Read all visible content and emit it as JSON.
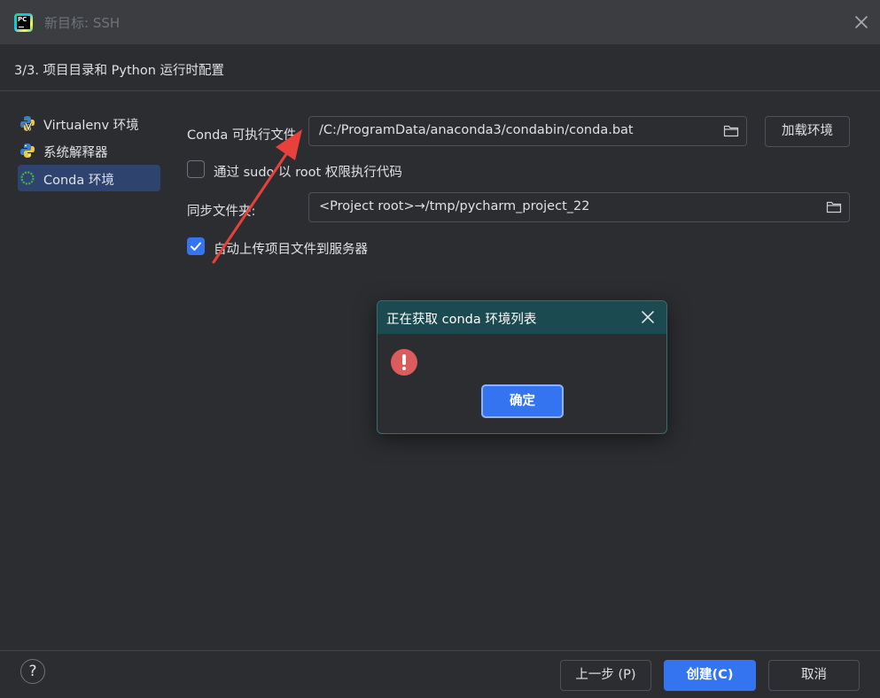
{
  "window": {
    "title": "新目标: SSH",
    "step_title": "3/3. 项目目录和 Python 运行时配置"
  },
  "sidebar": {
    "items": [
      {
        "label": "Virtualenv 环境",
        "icon": "virtualenv-icon",
        "selected": false
      },
      {
        "label": "系统解释器",
        "icon": "python-icon",
        "selected": false
      },
      {
        "label": "Conda 环境",
        "icon": "conda-icon",
        "selected": true
      }
    ]
  },
  "form": {
    "conda_label": "Conda 可执行文件:",
    "conda_value": "/C:/ProgramData/anaconda3/condabin/conda.bat",
    "load_env_button": "加载环境",
    "sudo_label": "通过 sudo 以 root 权限执行代码",
    "sudo_checked": false,
    "sync_label": "同步文件夹:",
    "sync_value": "<Project root>→/tmp/pycharm_project_22",
    "auto_upload_label": "自动上传项目文件到服务器",
    "auto_upload_checked": true
  },
  "dialog": {
    "title": "正在获取 conda 环境列表",
    "icon": "error-icon",
    "ok_button": "确定"
  },
  "footer": {
    "help": "?",
    "prev_button": "上一步 (P)",
    "create_button": "创建(C)",
    "cancel_button": "取消"
  },
  "colors": {
    "background": "#2b2d30",
    "titlebar": "#3b3d40",
    "accent": "#3574f0",
    "selected": "#2e436e",
    "dialog_header": "#1b4a50",
    "error": "#db5c5c",
    "annotation_arrow": "#e8413c"
  }
}
